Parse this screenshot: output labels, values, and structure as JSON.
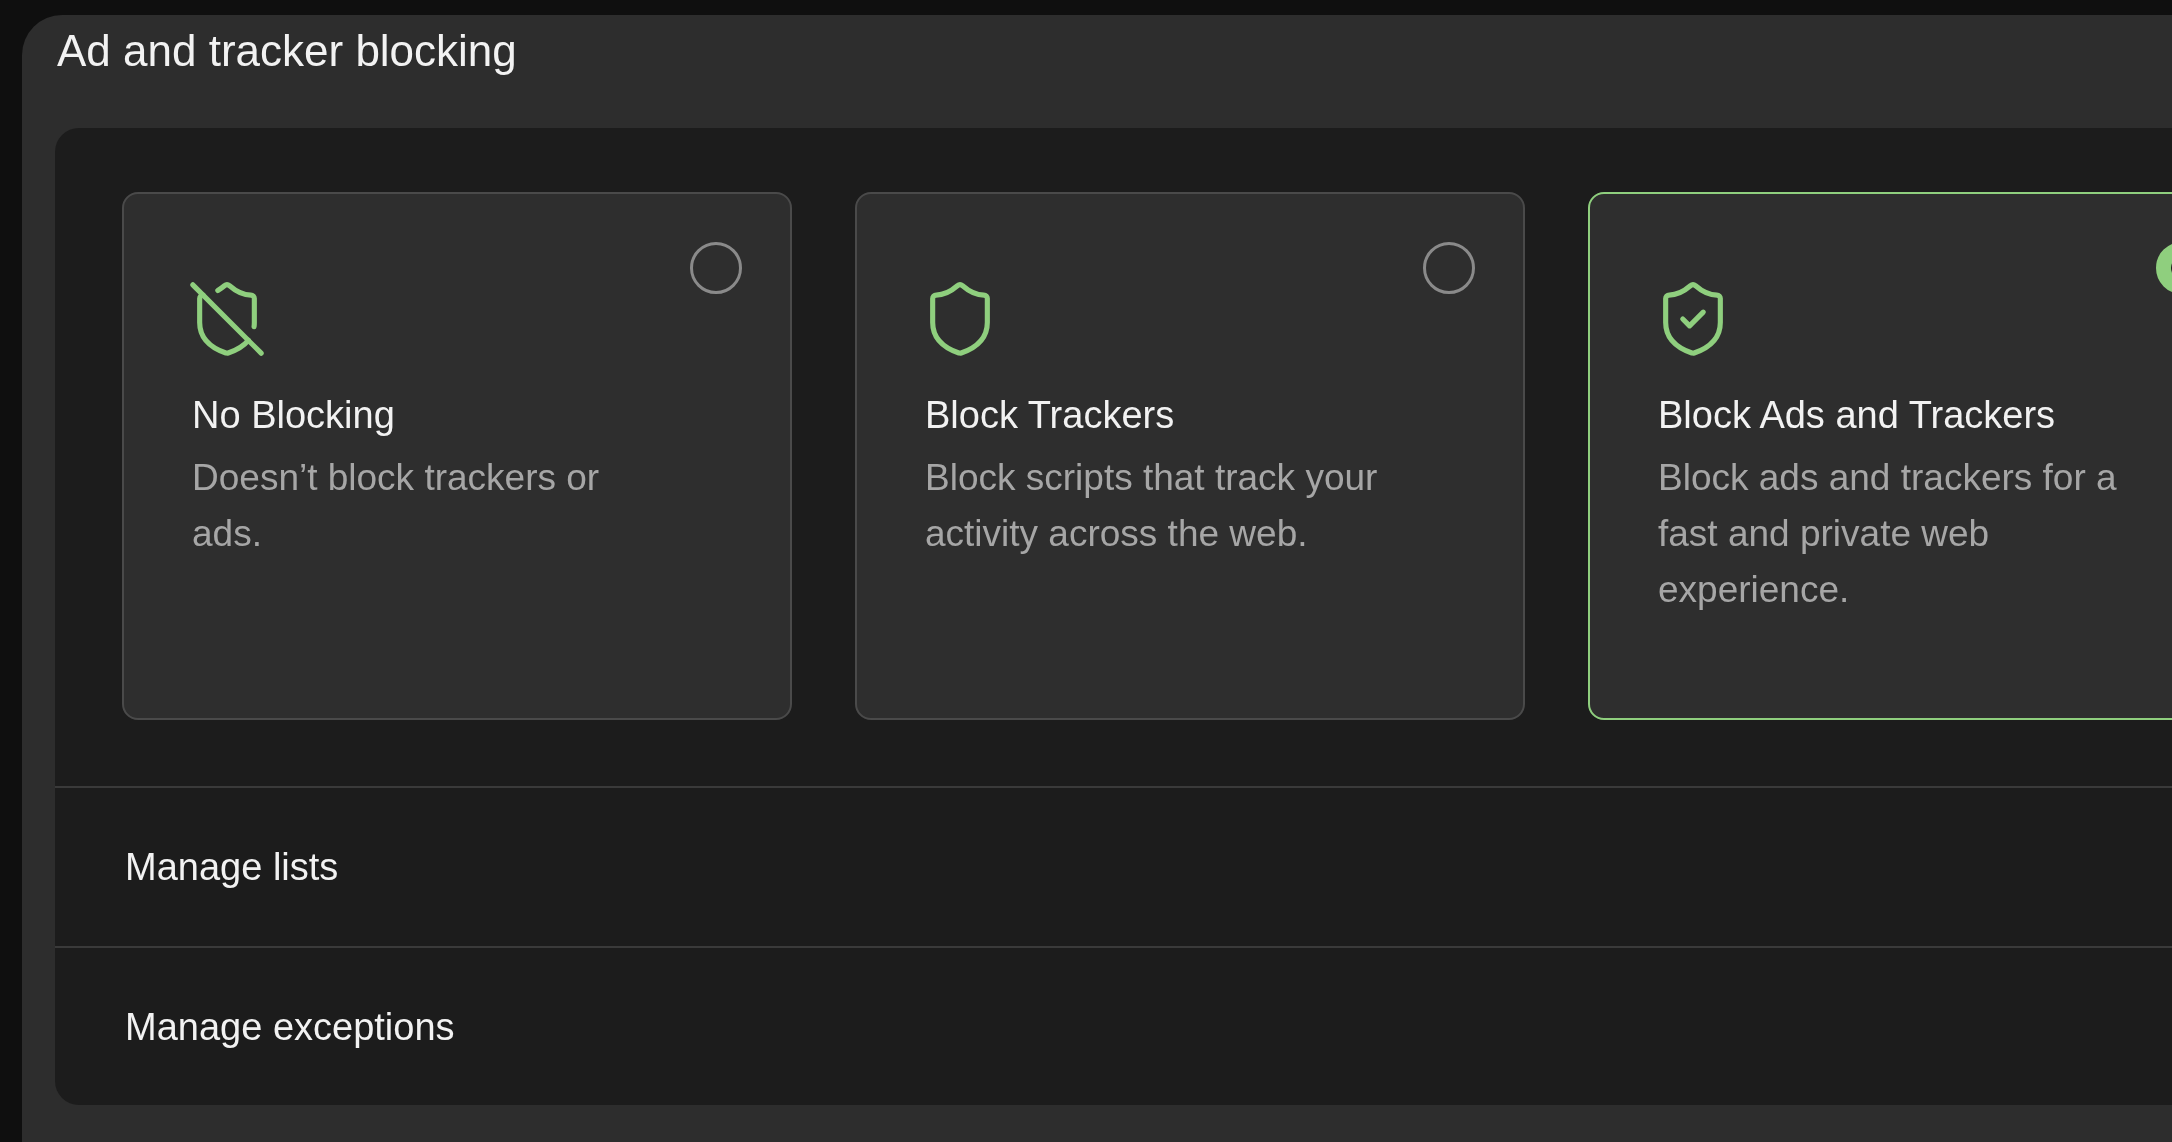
{
  "section": {
    "title": "Ad and tracker blocking"
  },
  "options": [
    {
      "kind": "shield-off",
      "title": "No Blocking",
      "description": "Doesn’t block trackers or ads.",
      "selected": false
    },
    {
      "kind": "shield",
      "title": "Block Trackers",
      "description": "Block scripts that track your activity across the web.",
      "selected": false
    },
    {
      "kind": "shield-check",
      "title": "Block Ads and Trackers",
      "description": "Block ads and trackers for a fast and private web experience.",
      "selected": true
    }
  ],
  "rows": [
    {
      "label": "Manage lists"
    },
    {
      "label": "Manage exceptions"
    }
  ]
}
